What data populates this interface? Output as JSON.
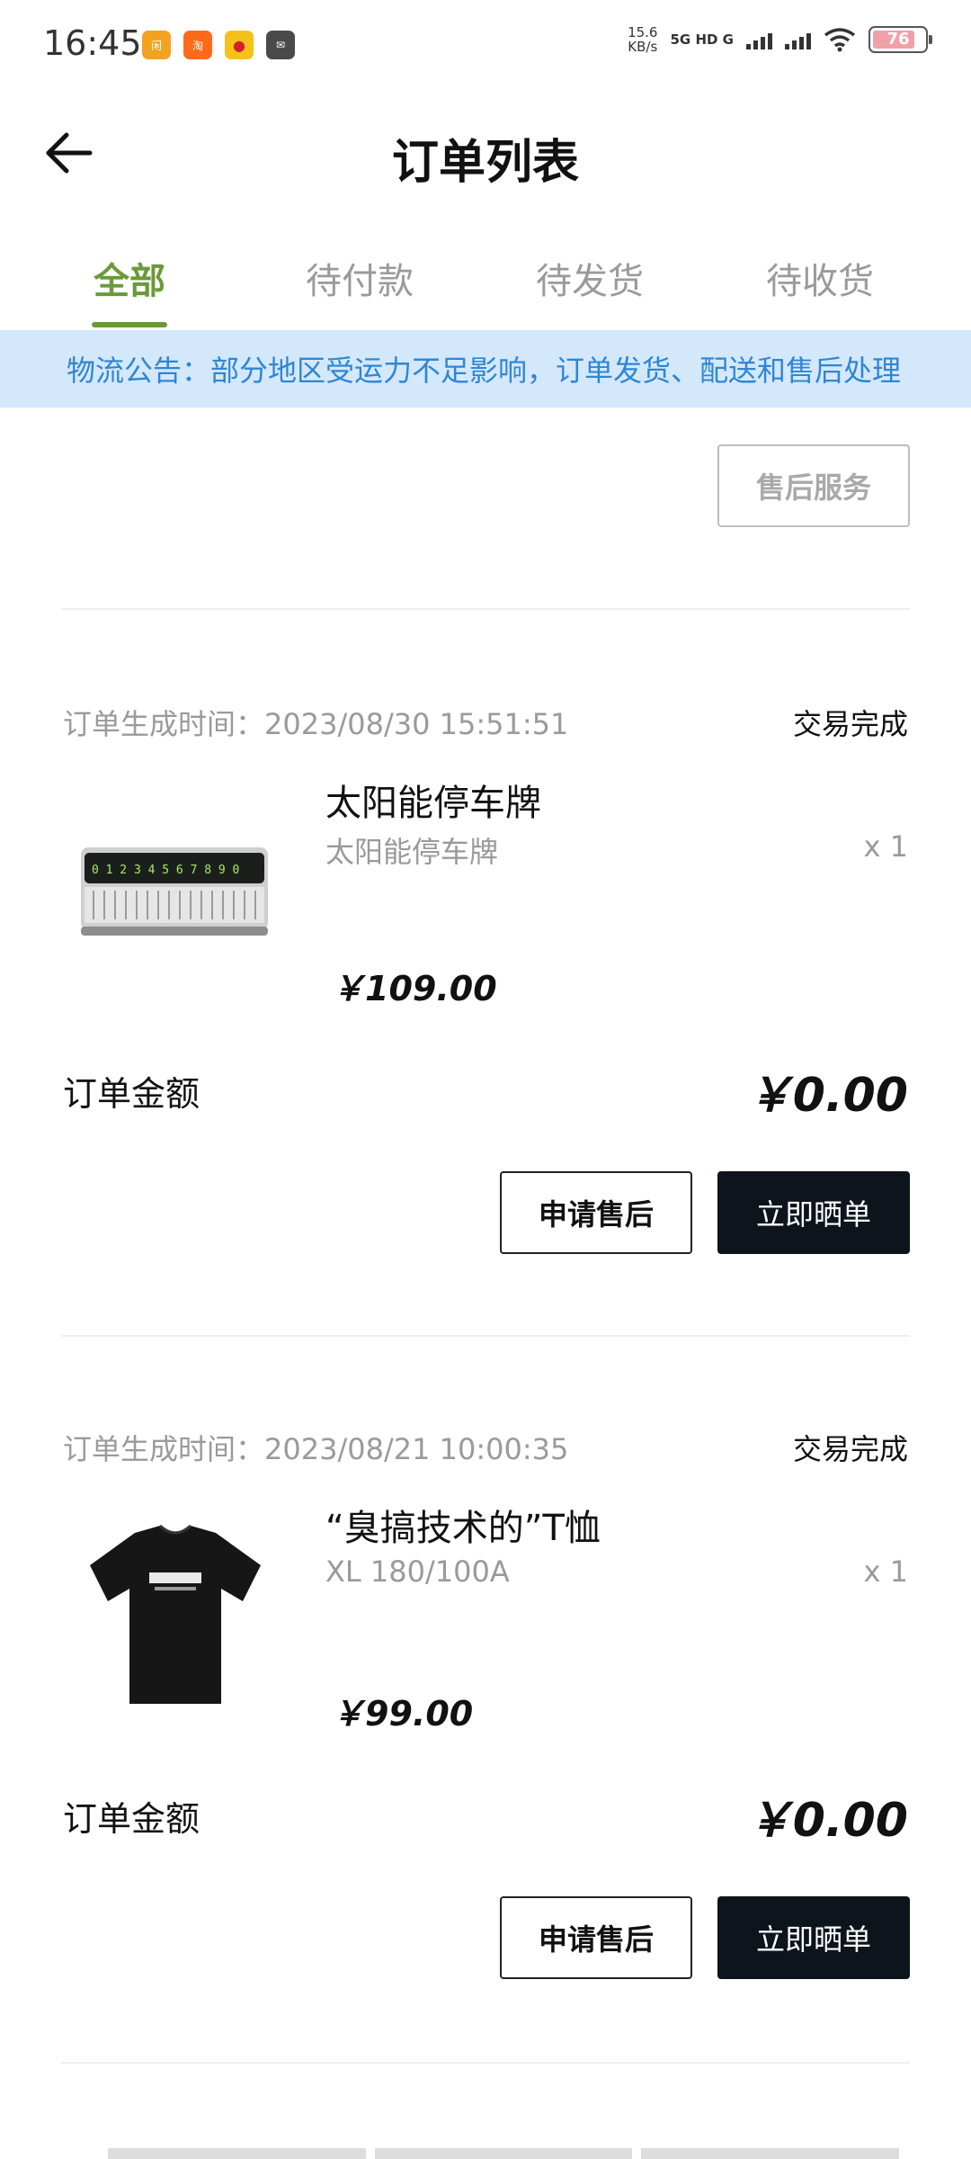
{
  "status_bar": {
    "time": "16:45",
    "speed_value": "15.6",
    "speed_unit": "KB/s",
    "network": "5G HD G",
    "battery": "76",
    "app_icons": [
      "xianyu-icon",
      "taobao-icon",
      "weibo-icon",
      "message-icon"
    ]
  },
  "header": {
    "title": "订单列表"
  },
  "tabs": [
    {
      "label": "全部",
      "active": true
    },
    {
      "label": "待付款",
      "active": false
    },
    {
      "label": "待发货",
      "active": false
    },
    {
      "label": "待收货",
      "active": false
    }
  ],
  "notice": {
    "text": "物流公告：部分地区受运力不足影响，订单发货、配送和售后处理"
  },
  "prev_order": {
    "after_sales_label": "售后服务"
  },
  "orders": [
    {
      "created_at": "订单生成时间：2023/08/30 15:51:51",
      "status": "交易完成",
      "product_name": "太阳能停车牌",
      "product_spec": "太阳能停车牌",
      "quantity": "x 1",
      "price": "￥109.00",
      "amount_label": "订单金额",
      "amount": "￥0.00",
      "apply_label": "申请售后",
      "share_label": "立即晒单",
      "thumb_icon": "parking-sign-image"
    },
    {
      "created_at": "订单生成时间：2023/08/21 10:00:35",
      "status": "交易完成",
      "product_name": "“臭搞技术的”T恤",
      "product_spec": "XL 180/100A",
      "quantity": "x 1",
      "price": "￥99.00",
      "amount_label": "订单金额",
      "amount": "￥0.00",
      "apply_label": "申请售后",
      "share_label": "立即晒单",
      "thumb_icon": "tshirt-image"
    }
  ],
  "colors": {
    "accent": "#6a9a39",
    "notice_bg": "#d4e8fb",
    "notice_text": "#2f86d4",
    "dark_button": "#0e141c"
  }
}
